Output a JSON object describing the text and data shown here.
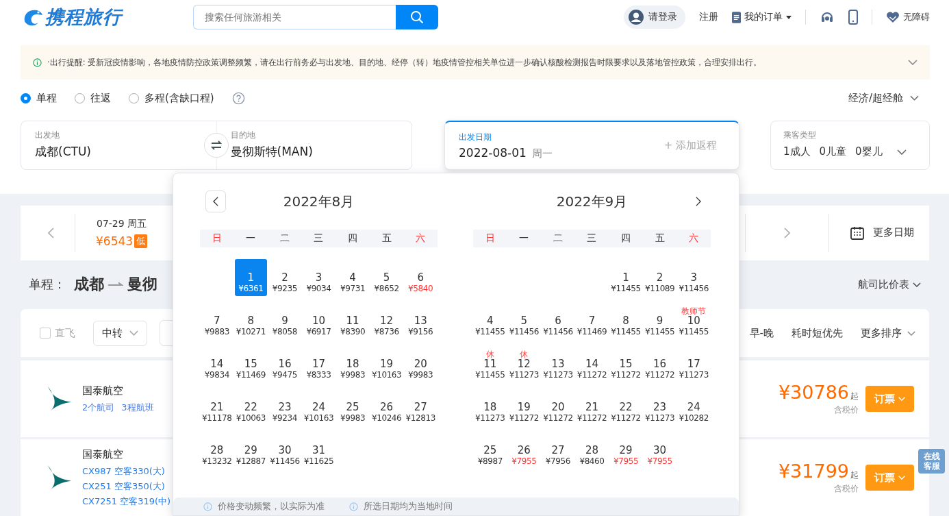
{
  "header": {
    "logo": "携程旅行",
    "search_placeholder": "搜索任何旅游相关",
    "login": "请登录",
    "register": "注册",
    "orders": "我的订单",
    "accessibility": "无障碍"
  },
  "notice": {
    "text": "·出行提醒: 受新冠疫情影响，各地疫情防控政策调整频繁，请在出行前务必与出发地、目的地、经停（转）地疫情管控相关单位进一步确认核酸检测报告时限要求以及落地管控政策，合理安排出行。",
    "expanded": false
  },
  "trip_types": [
    {
      "label": "单程",
      "selected": true
    },
    {
      "label": "往返",
      "selected": false
    },
    {
      "label": "多程(含缺口程)",
      "selected": false
    }
  ],
  "cabin": "经济/超经舱",
  "search_form": {
    "origin": {
      "label": "出发地",
      "value": "成都(CTU)"
    },
    "destination": {
      "label": "目的地",
      "value": "曼彻斯特(MAN)"
    },
    "date": {
      "label": "出发日期",
      "value": "2022-08-01",
      "weekday": "周一",
      "active": true
    },
    "return": "+ 添加返程",
    "passengers": {
      "label": "乘客类型",
      "values": [
        "1成人",
        "0儿童",
        "0婴儿"
      ]
    }
  },
  "date_strip": {
    "dates": [
      {
        "date": "07-29 周五",
        "price": "¥6543",
        "badge": "低"
      }
    ],
    "more": "更多日期"
  },
  "route": {
    "label": "单程：",
    "from": "成都",
    "to": "曼彻"
  },
  "compare": "航司比价表",
  "filters": {
    "direct": {
      "label": "直飞",
      "checked": false
    },
    "transfer": "中转",
    "sort_options": [
      "早-晚",
      "耗时短优先"
    ],
    "more_sort": "更多排序"
  },
  "flights": [
    {
      "airline": "国泰航空",
      "kind": "summary",
      "lines": [
        "2个航司",
        "3程航班"
      ],
      "price": "¥30786",
      "suffix": "起",
      "tax": "含税价",
      "button": "订票"
    },
    {
      "airline": "国泰航空",
      "kind": "segments",
      "lines": [
        "CX987 空客330(大)",
        "CX251 空客350(大)",
        "CX7251 空客319(中)"
      ],
      "price": "¥31799",
      "suffix": "起",
      "tax": "含税价",
      "button": "订票"
    }
  ],
  "calendar": {
    "months": [
      {
        "title": "2022年8月",
        "weekdays": [
          {
            "label": "日",
            "weekend": true
          },
          {
            "label": "一",
            "weekend": false
          },
          {
            "label": "二",
            "weekend": false
          },
          {
            "label": "三",
            "weekend": false
          },
          {
            "label": "四",
            "weekend": false
          },
          {
            "label": "五",
            "weekend": false
          },
          {
            "label": "六",
            "weekend": true
          }
        ],
        "days": [
          {
            "kind": "empty"
          },
          {
            "kind": "day",
            "day": "1",
            "price": "¥6361",
            "low": false,
            "selected": true
          },
          {
            "kind": "day",
            "day": "2",
            "price": "¥9235",
            "low": false,
            "selected": false
          },
          {
            "kind": "day",
            "day": "3",
            "price": "¥9034",
            "low": false,
            "selected": false
          },
          {
            "kind": "day",
            "day": "4",
            "price": "¥9731",
            "low": false,
            "selected": false
          },
          {
            "kind": "day",
            "day": "5",
            "price": "¥8652",
            "low": false,
            "selected": false
          },
          {
            "kind": "day",
            "day": "6",
            "price": "¥5840",
            "low": true,
            "selected": false
          },
          {
            "kind": "day",
            "day": "7",
            "price": "¥9883",
            "low": false,
            "selected": false
          },
          {
            "kind": "day",
            "day": "8",
            "price": "¥10271",
            "low": false,
            "selected": false
          },
          {
            "kind": "day",
            "day": "9",
            "price": "¥8058",
            "low": false,
            "selected": false
          },
          {
            "kind": "day",
            "day": "10",
            "price": "¥6917",
            "low": false,
            "selected": false
          },
          {
            "kind": "day",
            "day": "11",
            "price": "¥8390",
            "low": false,
            "selected": false
          },
          {
            "kind": "day",
            "day": "12",
            "price": "¥8736",
            "low": false,
            "selected": false
          },
          {
            "kind": "day",
            "day": "13",
            "price": "¥9156",
            "low": false,
            "selected": false
          },
          {
            "kind": "day",
            "day": "14",
            "price": "¥9834",
            "low": false,
            "selected": false
          },
          {
            "kind": "day",
            "day": "15",
            "price": "¥11469",
            "low": false,
            "selected": false
          },
          {
            "kind": "day",
            "day": "16",
            "price": "¥9475",
            "low": false,
            "selected": false
          },
          {
            "kind": "day",
            "day": "17",
            "price": "¥8333",
            "low": false,
            "selected": false
          },
          {
            "kind": "day",
            "day": "18",
            "price": "¥9983",
            "low": false,
            "selected": false
          },
          {
            "kind": "day",
            "day": "19",
            "price": "¥10163",
            "low": false,
            "selected": false
          },
          {
            "kind": "day",
            "day": "20",
            "price": "¥9983",
            "low": false,
            "selected": false
          },
          {
            "kind": "day",
            "day": "21",
            "price": "¥11178",
            "low": false,
            "selected": false
          },
          {
            "kind": "day",
            "day": "22",
            "price": "¥10063",
            "low": false,
            "selected": false
          },
          {
            "kind": "day",
            "day": "23",
            "price": "¥9234",
            "low": false,
            "selected": false
          },
          {
            "kind": "day",
            "day": "24",
            "price": "¥10163",
            "low": false,
            "selected": false
          },
          {
            "kind": "day",
            "day": "25",
            "price": "¥9983",
            "low": false,
            "selected": false
          },
          {
            "kind": "day",
            "day": "26",
            "price": "¥10246",
            "low": false,
            "selected": false
          },
          {
            "kind": "day",
            "day": "27",
            "price": "¥12813",
            "low": false,
            "selected": false
          },
          {
            "kind": "day",
            "day": "28",
            "price": "¥13232",
            "low": false,
            "selected": false
          },
          {
            "kind": "day",
            "day": "29",
            "price": "¥12887",
            "low": false,
            "selected": false
          },
          {
            "kind": "day",
            "day": "30",
            "price": "¥11456",
            "low": false,
            "selected": false
          },
          {
            "kind": "day",
            "day": "31",
            "price": "¥11625",
            "low": false,
            "selected": false
          }
        ]
      },
      {
        "title": "2022年9月",
        "weekdays": [
          {
            "label": "日",
            "weekend": true
          },
          {
            "label": "一",
            "weekend": false
          },
          {
            "label": "二",
            "weekend": false
          },
          {
            "label": "三",
            "weekend": false
          },
          {
            "label": "四",
            "weekend": false
          },
          {
            "label": "五",
            "weekend": false
          },
          {
            "label": "六",
            "weekend": true
          }
        ],
        "days": [
          {
            "kind": "empty"
          },
          {
            "kind": "empty"
          },
          {
            "kind": "empty"
          },
          {
            "kind": "empty"
          },
          {
            "kind": "day",
            "day": "1",
            "price": "¥11455",
            "low": false,
            "selected": false
          },
          {
            "kind": "day",
            "day": "2",
            "price": "¥11089",
            "low": false,
            "selected": false
          },
          {
            "kind": "day",
            "day": "3",
            "price": "¥11456",
            "low": false,
            "selected": false
          },
          {
            "kind": "day",
            "day": "4",
            "price": "¥11455",
            "low": false,
            "selected": false
          },
          {
            "kind": "day",
            "day": "5",
            "price": "¥11456",
            "low": false,
            "selected": false
          },
          {
            "kind": "day",
            "day": "6",
            "price": "¥11456",
            "low": false,
            "selected": false
          },
          {
            "kind": "day",
            "day": "7",
            "price": "¥11469",
            "low": false,
            "selected": false
          },
          {
            "kind": "day",
            "day": "8",
            "price": "¥11455",
            "low": false,
            "selected": false
          },
          {
            "kind": "day",
            "day": "9",
            "price": "¥11455",
            "low": false,
            "selected": false
          },
          {
            "kind": "day",
            "day": "10",
            "price": "¥11455",
            "low": false,
            "selected": false,
            "note": "教师节"
          },
          {
            "kind": "day",
            "day": "11",
            "price": "¥11455",
            "low": false,
            "selected": false,
            "note": "休"
          },
          {
            "kind": "day",
            "day": "12",
            "price": "¥11273",
            "low": false,
            "selected": false,
            "note": "休"
          },
          {
            "kind": "day",
            "day": "13",
            "price": "¥11273",
            "low": false,
            "selected": false
          },
          {
            "kind": "day",
            "day": "14",
            "price": "¥11272",
            "low": false,
            "selected": false
          },
          {
            "kind": "day",
            "day": "15",
            "price": "¥11272",
            "low": false,
            "selected": false
          },
          {
            "kind": "day",
            "day": "16",
            "price": "¥11272",
            "low": false,
            "selected": false
          },
          {
            "kind": "day",
            "day": "17",
            "price": "¥11273",
            "low": false,
            "selected": false
          },
          {
            "kind": "day",
            "day": "18",
            "price": "¥11273",
            "low": false,
            "selected": false
          },
          {
            "kind": "day",
            "day": "19",
            "price": "¥11272",
            "low": false,
            "selected": false
          },
          {
            "kind": "day",
            "day": "20",
            "price": "¥11272",
            "low": false,
            "selected": false
          },
          {
            "kind": "day",
            "day": "21",
            "price": "¥11272",
            "low": false,
            "selected": false
          },
          {
            "kind": "day",
            "day": "22",
            "price": "¥11272",
            "low": false,
            "selected": false
          },
          {
            "kind": "day",
            "day": "23",
            "price": "¥11273",
            "low": false,
            "selected": false
          },
          {
            "kind": "day",
            "day": "24",
            "price": "¥10282",
            "low": false,
            "selected": false
          },
          {
            "kind": "day",
            "day": "25",
            "price": "¥8987",
            "low": false,
            "selected": false
          },
          {
            "kind": "day",
            "day": "26",
            "price": "¥7955",
            "low": true,
            "selected": false
          },
          {
            "kind": "day",
            "day": "27",
            "price": "¥7956",
            "low": false,
            "selected": false
          },
          {
            "kind": "day",
            "day": "28",
            "price": "¥8460",
            "low": false,
            "selected": false
          },
          {
            "kind": "day",
            "day": "29",
            "price": "¥7955",
            "low": true,
            "selected": false
          },
          {
            "kind": "day",
            "day": "30",
            "price": "¥7955",
            "low": true,
            "selected": false
          }
        ]
      }
    ],
    "notes": [
      "价格变动频繁，以实际为准",
      "所选日期均为当地时间"
    ]
  },
  "chat_button": "在线客服"
}
